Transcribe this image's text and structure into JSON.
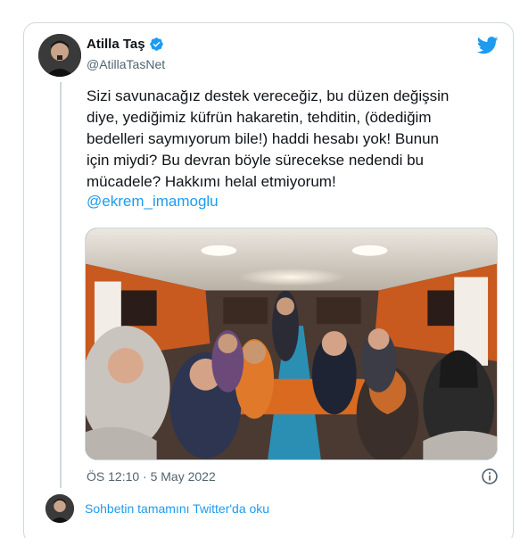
{
  "colors": {
    "accent": "#1d9bf0",
    "text": "#0f1419",
    "muted": "#536471",
    "border": "#cfd9de"
  },
  "author": {
    "name": "Atilla Taş",
    "handle": "@AtillaTasNet",
    "verified_icon": "verified-badge-icon"
  },
  "brand_icon": "twitter-bird-icon",
  "tweet": {
    "text": "Sizi savunacağız destek vereceğiz, bu düzen değişsin\ndiye, yediğimiz küfrün hakaretin, tehditin, (ödediğim\nbedelleri saymıyorum bile!) haddi hesabı yok! Bunun\niçin miydi? Bu devran böyle sürecekse nedendi bu\nmücadele? Hakkımı helal etmiyorum!",
    "mention": "@ekrem_imamoglu",
    "timestamp": "ÖS 12:10 · 5 May 2022"
  },
  "footer": {
    "read_more": "Sohbetin tamamını Twitter'da oku",
    "info_icon": "info-icon"
  }
}
